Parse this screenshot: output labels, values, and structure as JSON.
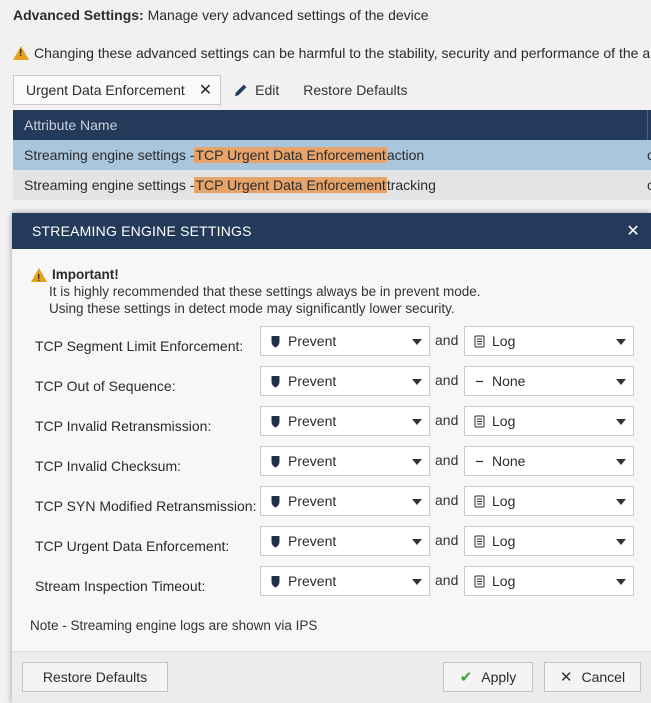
{
  "background": {
    "title_bold": "Advanced Settings:",
    "title_rest": " Manage very advanced settings of the device",
    "warning": "Changing these advanced settings can be harmful to the stability, security and performance of the app",
    "filter_chip": "Urgent Data Enforcement",
    "edit_label": "Edit",
    "restore_label": "Restore Defaults",
    "table": {
      "header": "Attribute Name",
      "header_col2": "T",
      "rows": [
        {
          "prefix": "Streaming engine settings - ",
          "highlight": "TCP Urgent Data Enforcement",
          "suffix": " action",
          "col2": "c"
        },
        {
          "prefix": "Streaming engine settings - ",
          "highlight": "TCP Urgent Data Enforcement",
          "suffix": " tracking",
          "col2": "c"
        }
      ]
    }
  },
  "modal": {
    "title": "STREAMING ENGINE SETTINGS",
    "important_title": "Important!",
    "important_line1": "It is highly recommended that these settings always be in prevent mode.",
    "important_line2": "Using these settings in detect mode may significantly lower security.",
    "and_word": "and",
    "settings": [
      {
        "label": "TCP Segment Limit Enforcement:",
        "action": "Prevent",
        "track": "Log"
      },
      {
        "label": "TCP Out of Sequence:",
        "action": "Prevent",
        "track": "None"
      },
      {
        "label": "TCP Invalid Retransmission:",
        "action": "Prevent",
        "track": "Log"
      },
      {
        "label": "TCP Invalid Checksum:",
        "action": "Prevent",
        "track": "None"
      },
      {
        "label": "TCP SYN Modified Retransmission:",
        "action": "Prevent",
        "track": "Log"
      },
      {
        "label": "TCP Urgent Data Enforcement:",
        "action": "Prevent",
        "track": "Log"
      },
      {
        "label": "Stream Inspection Timeout:",
        "action": "Prevent",
        "track": "Log"
      }
    ],
    "note": "Note - Streaming engine logs are shown via IPS",
    "buttons": {
      "restore": "Restore Defaults",
      "apply": "Apply",
      "cancel": "Cancel"
    }
  },
  "colors": {
    "header_navy": "#233a5a",
    "selected_row": "#a9c6dc",
    "highlight": "#e7a46a",
    "warning": "#e8a11a",
    "apply_check": "#3aa33a"
  }
}
